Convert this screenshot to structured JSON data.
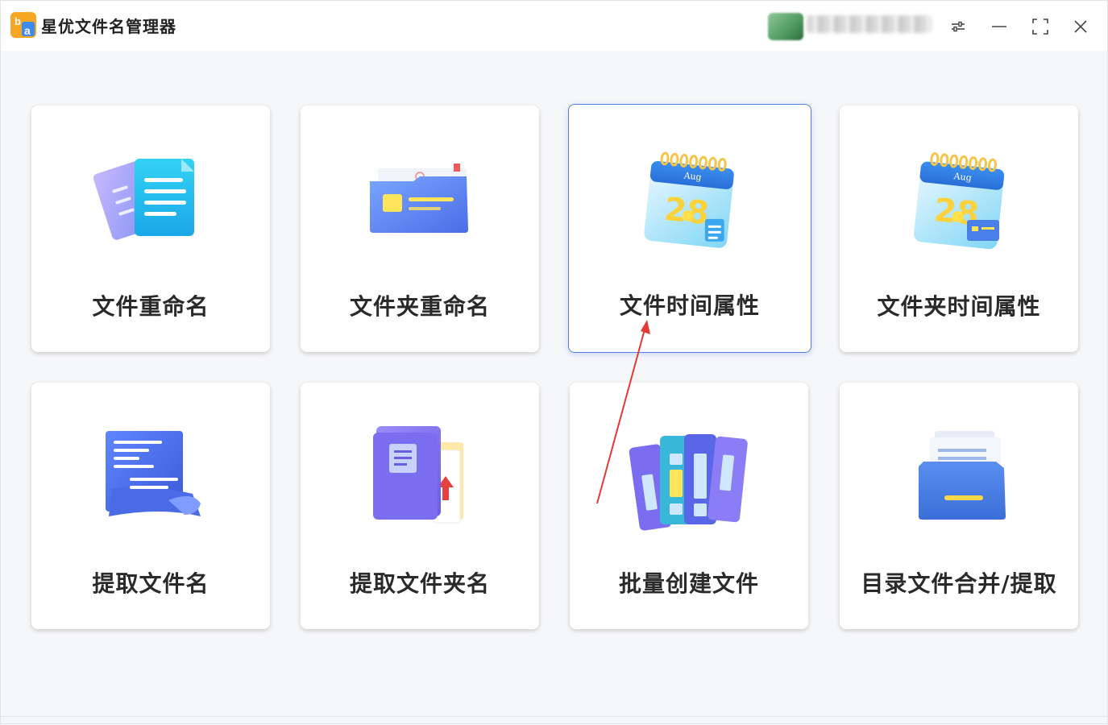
{
  "app": {
    "title": "星优文件名管理器",
    "logo_icon": "app-logo-icon"
  },
  "titlebar": {
    "user_name": "",
    "settings_icon": "sliders-icon",
    "minimize_icon": "minimize-icon",
    "maximize_icon": "maximize-icon",
    "close_icon": "close-icon"
  },
  "tools": [
    {
      "label": "文件重命名",
      "icon": "documents-icon"
    },
    {
      "label": "文件夹重命名",
      "icon": "folder-card-icon"
    },
    {
      "label": "文件时间属性",
      "icon": "calendar-file-icon",
      "calendar_month": "Aug",
      "calendar_day": "28"
    },
    {
      "label": "文件夹时间属性",
      "icon": "calendar-folder-icon",
      "calendar_month": "Aug",
      "calendar_day": "28"
    },
    {
      "label": "提取文件名",
      "icon": "scroll-document-icon"
    },
    {
      "label": "提取文件夹名",
      "icon": "folder-extract-icon"
    },
    {
      "label": "批量创建文件",
      "icon": "binders-icon"
    },
    {
      "label": "目录文件合并/提取",
      "icon": "file-drawer-icon"
    }
  ],
  "selected_tool": 2,
  "colors": {
    "accent": "#4f7ee8",
    "annotation_arrow": "#e53935"
  }
}
